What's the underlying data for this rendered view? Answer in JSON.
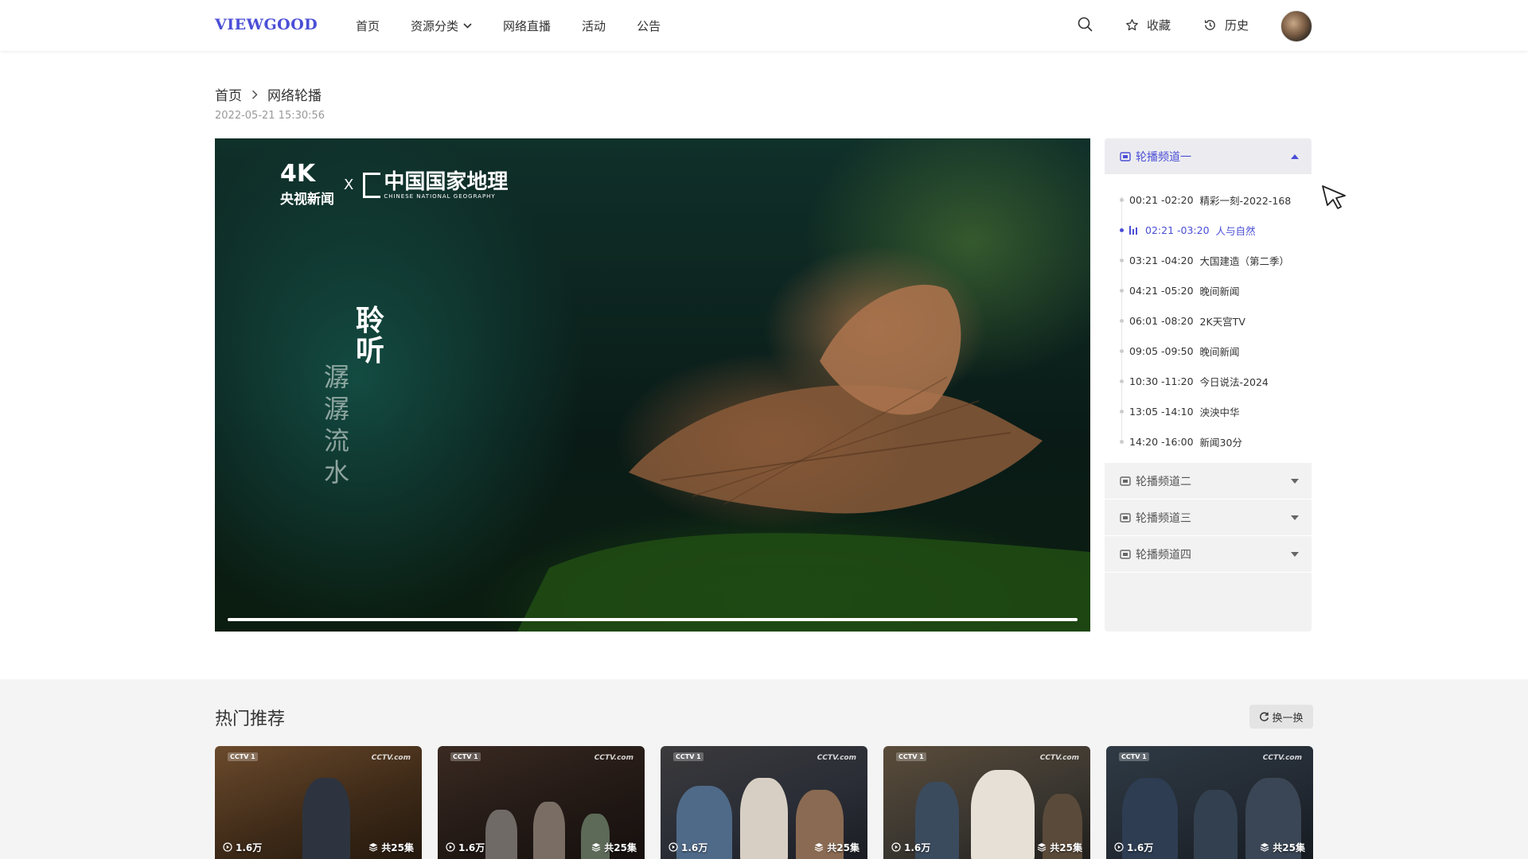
{
  "header": {
    "logo": "VIEWGOOD",
    "nav": [
      "首页",
      "资源分类",
      "网络直播",
      "活动",
      "公告"
    ],
    "favorites_label": "收藏",
    "history_label": "历史"
  },
  "breadcrumb": {
    "home": "首页",
    "current": "网络轮播"
  },
  "timestamp": "2022-05-21  15:30:56",
  "video": {
    "logo_4k": "4K",
    "logo_cctv_news": "央视新闻",
    "logo_x": "X",
    "logo_cng": "中国国家地理",
    "logo_cng_en": "CHINESE NATIONAL GEOGRAPHY",
    "vertical_title": "聆听",
    "vertical_subtitle": "潺潺流水",
    "progress": 1.0
  },
  "channels": [
    {
      "name": "轮播频道一",
      "expanded": true,
      "programs": [
        {
          "time": "00:21 -02:20",
          "title": "精彩一刻-2022-168",
          "active": false
        },
        {
          "time": "02:21 -03:20",
          "title": "人与自然",
          "active": true
        },
        {
          "time": "03:21 -04:20",
          "title": "大国建造（第二季）",
          "active": false
        },
        {
          "time": "04:21 -05:20",
          "title": "晚间新闻",
          "active": false
        },
        {
          "time": "06:01 -08:20",
          "title": "2K天宫TV",
          "active": false
        },
        {
          "time": "09:05 -09:50",
          "title": "晚间新闻",
          "active": false
        },
        {
          "time": "10:30 -11:20",
          "title": "今日说法-2024",
          "active": false
        },
        {
          "time": "13:05 -14:10",
          "title": "泱泱中华",
          "active": false
        },
        {
          "time": "14:20 -16:00",
          "title": "新闻30分",
          "active": false
        }
      ]
    },
    {
      "name": "轮播频道二",
      "expanded": false
    },
    {
      "name": "轮播频道三",
      "expanded": false
    },
    {
      "name": "轮播频道四",
      "expanded": false
    }
  ],
  "hot": {
    "title": "热门推荐",
    "refresh_label": "换一换",
    "cards": [
      {
        "views": "1.6万",
        "episodes": "共25集",
        "channel": "CCTV 1",
        "site": "CCTV.com"
      },
      {
        "views": "1.6万",
        "episodes": "共25集",
        "channel": "CCTV 1",
        "site": "CCTV.com"
      },
      {
        "views": "1.6万",
        "episodes": "共25集",
        "channel": "CCTV 1",
        "site": "CCTV.com"
      },
      {
        "views": "1.6万",
        "episodes": "共25集",
        "channel": "CCTV 1",
        "site": "CCTV.com"
      },
      {
        "views": "1.6万",
        "episodes": "共25集",
        "channel": "CCTV 1",
        "site": "CCTV.com"
      }
    ]
  },
  "colors": {
    "accent": "#4b4fd6",
    "panel_bg": "#f2f2f2",
    "section_bg": "#f4f4f4"
  }
}
